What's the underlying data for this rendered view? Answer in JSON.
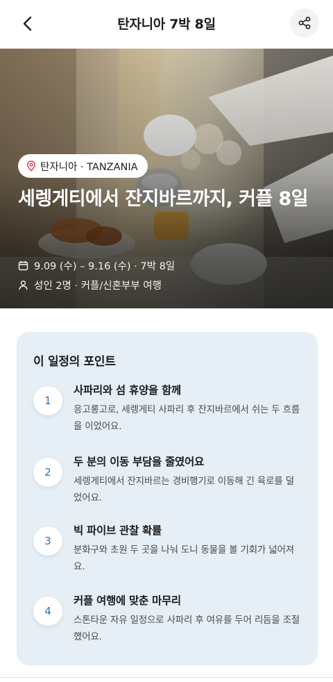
{
  "nav": {
    "title": "탄자니아 7박 8일",
    "back_icon": "chevron-left-icon",
    "share_icon": "share-icon"
  },
  "hero": {
    "location_icon": "location-pin-icon",
    "location": "탄자니아 · TANZANIA",
    "title": "세렝게티에서 잔지바르까지, 커플 8일",
    "date_icon": "calendar-icon",
    "dates": "9.09 (수) – 9.16 (수) · 7박 8일",
    "people_icon": "person-icon",
    "travelers": "성인 2명 · 커플/신혼부부 여행"
  },
  "points": {
    "heading": "이 일정의 포인트",
    "items": [
      {
        "num": "1",
        "title": "사파리와 섬 휴양을 함께",
        "desc": "응고롱고로, 세렝게티 사파리 후 잔지바르에서 쉬는 두 흐름을 이었어요."
      },
      {
        "num": "2",
        "title": "두 분의 이동 부담을 줄였어요",
        "desc": "세렝게티에서 잔지바르는 경비행기로 이동해 긴 육로를 덜었어요."
      },
      {
        "num": "3",
        "title": "빅 파이브 관찰 확률",
        "desc": "분화구와 초원 두 곳을 나눠 도니 동물을 볼 기회가 넓어져요."
      },
      {
        "num": "4",
        "title": "커플 여행에 맞춘 마무리",
        "desc": "스톤타운 자유 일정으로 사파리 후 여유를 두어 리듬을 조절했어요."
      }
    ]
  },
  "colors": {
    "accent": "#2f6fb0",
    "card_bg": "#e6eff5",
    "pin": "#e0475a"
  }
}
